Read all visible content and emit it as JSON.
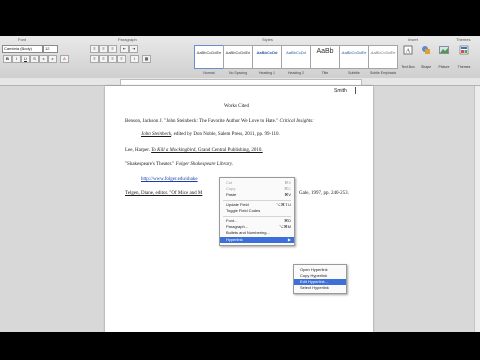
{
  "ribbon": {
    "groups": [
      "Font",
      "Paragraph",
      "Styles",
      "Insert",
      "Themes"
    ],
    "font_name": "Cambria (Body)",
    "font_size": "12",
    "styles": [
      {
        "sample": "AaBbCcDdEe",
        "name": "Normal"
      },
      {
        "sample": "AaBbCcDdEe",
        "name": "No Spacing"
      },
      {
        "sample": "AaBbCcDd",
        "name": "Heading 1"
      },
      {
        "sample": "AaBbCcDd",
        "name": "Heading 2"
      },
      {
        "sample": "AaBb",
        "name": "Title"
      },
      {
        "sample": "AaBbCcDdEe",
        "name": "Subtitle"
      },
      {
        "sample": "AaBbCcDdEe",
        "name": "Subtle Emphasis"
      }
    ],
    "tools": [
      "Text Box",
      "Shape",
      "Picture",
      "Themes"
    ]
  },
  "document": {
    "header_name": "Smith",
    "title": "Works Cited",
    "entry1_a": "Benson, Jackson J. \"John Steinbeck: The Favorite Author We Love to Hate.\"",
    "entry1_a_italic": "Critical Insights:",
    "entry1_b_link": "John Steinbeck",
    "entry1_b": ", edited by Don Noble, Salem Press, 2011, pp. 99-110.",
    "entry2_a": "Lee, Harper.",
    "entry2_b_italic": "To Kill a Mockingbird",
    "entry2_c": ", Grand Central Publishing, 2010.",
    "entry3_a": "\"Shakespeare's Theater.\"",
    "entry3_b_italic": "Folger Shakespeare Library",
    "entry3_c": ".",
    "entry3_url": "http://www.folger.edu/shake",
    "entry4_a": "Telgen, Diane, editor. \"Of Mice and M",
    "entry4_b": "Gale, 1997, pp. 240-253."
  },
  "context_menu": {
    "items": [
      {
        "label": "Cut",
        "shortcut": "⌘X"
      },
      {
        "label": "Copy",
        "shortcut": "⌘C"
      },
      {
        "label": "Paste",
        "shortcut": "⌘V"
      },
      {
        "label": "Update Field",
        "shortcut": "⌥⌘⇧U"
      },
      {
        "label": "Toggle Field Codes",
        "shortcut": ""
      },
      {
        "label": "Font...",
        "shortcut": "⌘D"
      },
      {
        "label": "Paragraph...",
        "shortcut": "⌥⌘M"
      },
      {
        "label": "Bullets and Numbering...",
        "shortcut": ""
      },
      {
        "label": "Hyperlink",
        "shortcut": ""
      }
    ]
  },
  "submenu": {
    "items": [
      "Open Hyperlink",
      "Copy Hyperlink",
      "Edit Hyperlink...",
      "Select Hyperlink"
    ]
  },
  "colors": {
    "highlight": "#3d6fd8",
    "link": "#1a3ea8"
  }
}
